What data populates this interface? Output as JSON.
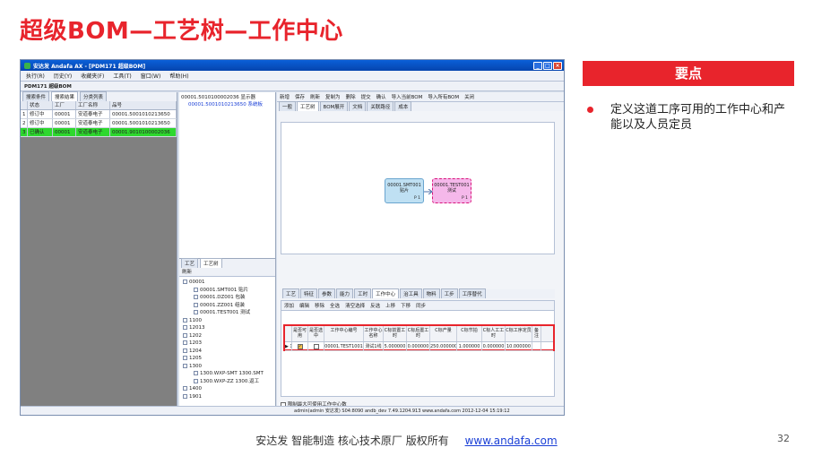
{
  "slide": {
    "title": "超级BOM—工艺树—工作中心",
    "points_header": "要点",
    "point_1": "定义这道工序可用的工作中心和产能以及人员定员",
    "footer_text": "安达发  智能制造 核心技术原厂  版权所有",
    "footer_link": "www.andafa.com",
    "page_number": "32"
  },
  "app": {
    "title": "安达发 Andafa AX - [PDM171 超级BOM]",
    "menu": [
      "执行(R)",
      "历史(Y)",
      "收藏夹(F)",
      "工具(T)",
      "窗口(W)",
      "帮助(H)"
    ],
    "bom_label": "PDM171 超级BOM",
    "left_tabs": [
      "搜索条件",
      "搜索结果",
      "分类列表"
    ],
    "grid_headers": [
      "状态",
      "工厂",
      "工厂名称",
      "品号"
    ],
    "grid_rows": [
      {
        "n": "1",
        "status": "修订中",
        "factory": "00001",
        "name": "安道泰电子",
        "code": "00001.5001010213650"
      },
      {
        "n": "2",
        "status": "修订中",
        "factory": "00001",
        "name": "安道泰电子",
        "code": "00001.5001010213650"
      },
      {
        "n": "3",
        "status": "已确认",
        "factory": "00001",
        "name": "安道泰电子",
        "code": "00001.9010100002036"
      }
    ],
    "tree_top": [
      "00001.5010100002036 显示器",
      "00001.5001010213650 系统板"
    ],
    "craft_tabs": [
      "工艺",
      "工艺树"
    ],
    "craft_toolbar": "刷新",
    "craft_tree": [
      "00001",
      "00001.SMT001 贴片",
      "00001.DZ001 包装",
      "00001.ZZ001 组装",
      "00001.TEST001 测试",
      "1100",
      "12013",
      "1202",
      "1203",
      "1204",
      "1205",
      "1300",
      "1300.WXP-SMT 1300.SMT",
      "1300.WXP-ZZ 1300.返工",
      "1400",
      "1901"
    ],
    "right_toolbar": [
      "新增",
      "保存",
      "刷新",
      "复制为",
      "删除",
      "提交",
      "确认",
      "导入当前BOM",
      "导入所有BOM",
      "关闭"
    ],
    "upper_tabs": [
      "一般",
      "工艺树",
      "BOM展开",
      "文档",
      "关联路径",
      "成本"
    ],
    "node1": {
      "code": "00001.SMT001",
      "name": "贴片",
      "tag": "P 1"
    },
    "node2": {
      "code": "00001.TEST001",
      "name": "测试",
      "tag": "P 1"
    },
    "lower_tabs": [
      "工艺",
      "特征",
      "参数",
      "能力",
      "工时",
      "工作中心",
      "治工具",
      "物料",
      "工步",
      "工序替代"
    ],
    "lower_toolbar": [
      "添加",
      "编辑",
      "移除",
      "全选",
      "清空选择",
      "反选",
      "上移",
      "下移",
      "同步"
    ],
    "wc_headers": [
      "",
      "是否可用",
      "是否选中",
      "工作中心编号",
      "工作中心名称",
      "C标前置工时",
      "C标后置工时",
      "C标产量",
      "C标节拍",
      "C标人工工时",
      "C标工序定员",
      "备注"
    ],
    "wc_row": [
      "▶ 1",
      "",
      "",
      "00001.TEST1001",
      "测试1线",
      "5.000000",
      "0.000000",
      "250.000000",
      "1.000000",
      "0.000000",
      "10.000000",
      ""
    ],
    "limit_label": "限制最大可使用工作中心数",
    "status": "admin(admin 安达发)  S04:8090  andb_dev  7.49.1204.913  www.andafa.com  2012-12-04 15:19:12"
  },
  "colors": {
    "brand_red": "#e8242c",
    "selected_row": "#2ed82e"
  }
}
